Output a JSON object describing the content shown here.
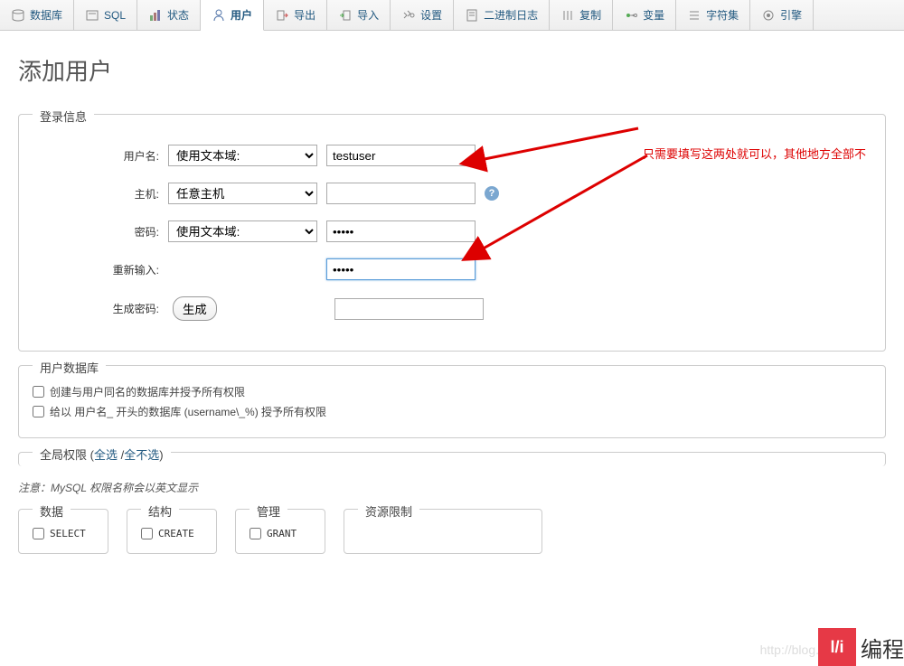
{
  "tabs": [
    {
      "label": "数据库",
      "icon": "database"
    },
    {
      "label": "SQL",
      "icon": "sql"
    },
    {
      "label": "状态",
      "icon": "status"
    },
    {
      "label": "用户",
      "icon": "user",
      "active": true
    },
    {
      "label": "导出",
      "icon": "export"
    },
    {
      "label": "导入",
      "icon": "import"
    },
    {
      "label": "设置",
      "icon": "settings"
    },
    {
      "label": "二进制日志",
      "icon": "log"
    },
    {
      "label": "复制",
      "icon": "copy"
    },
    {
      "label": "变量",
      "icon": "var"
    },
    {
      "label": "字符集",
      "icon": "charset"
    },
    {
      "label": "引擎",
      "icon": "engine"
    }
  ],
  "page_title": "添加用户",
  "login_info": {
    "legend": "登录信息",
    "username_label": "用户名:",
    "username_select": "使用文本域:",
    "username_value": "testuser",
    "host_label": "主机:",
    "host_select": "任意主机",
    "host_value": "",
    "password_label": "密码:",
    "password_select": "使用文本域:",
    "password_value": "•••••",
    "retype_label": "重新输入:",
    "retype_value": "•••••",
    "generate_label": "生成密码:",
    "generate_button": "生成"
  },
  "user_db": {
    "legend": "用户数据库",
    "option1": "创建与用户同名的数据库并授予所有权限",
    "option2": "给以 用户名_ 开头的数据库 (username\\_%) 授予所有权限"
  },
  "global_priv": {
    "legend_prefix": "全局权限 (",
    "select_all": "全选",
    "separator": " /",
    "deselect_all": "全不选",
    "legend_suffix": ")"
  },
  "note": "注意：MySQL 权限名称会以英文显示",
  "priv_groups": {
    "data": {
      "legend": "数据",
      "items": [
        "SELECT"
      ]
    },
    "structure": {
      "legend": "结构",
      "items": [
        "CREATE"
      ]
    },
    "admin": {
      "legend": "管理",
      "items": [
        "GRANT"
      ]
    },
    "resource": {
      "legend": "资源限制",
      "items": []
    }
  },
  "annotation_text": "只需要填写这两处就可以，其他地方全部不",
  "watermark": "http://blog.cs",
  "logo": {
    "badge": "l/i",
    "text": "编程"
  }
}
